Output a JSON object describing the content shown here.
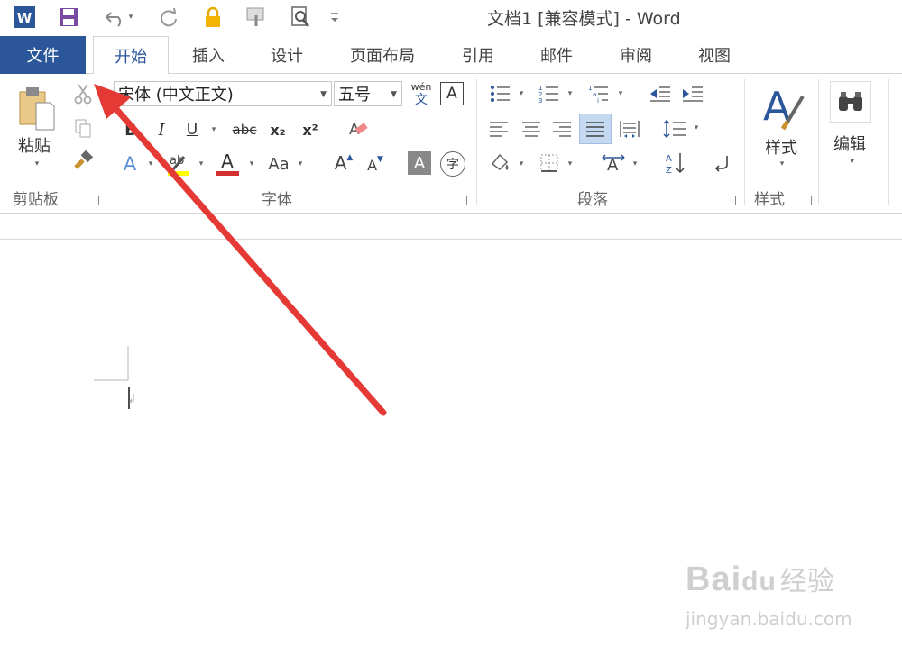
{
  "window": {
    "title": "文档1 [兼容模式] - Word"
  },
  "tabs": {
    "file": "文件",
    "home": "开始",
    "insert": "插入",
    "design": "设计",
    "layout": "页面布局",
    "references": "引用",
    "mailings": "邮件",
    "review": "审阅",
    "view": "视图"
  },
  "clipboard": {
    "paste_label": "粘贴",
    "group_label": "剪贴板"
  },
  "font": {
    "name": "宋体 (中文正文)",
    "size": "五号",
    "group_label": "字体",
    "phonetic_top": "wén",
    "phonetic_bottom": "文",
    "border_char": "A",
    "bold": "B",
    "italic": "I",
    "underline": "U",
    "strike": "abc",
    "subscript": "x₂",
    "superscript": "x²",
    "grow": "A",
    "shrink": "A",
    "change_case": "Aa",
    "effect": "A",
    "color": "A",
    "shading": "A",
    "enclose": "字"
  },
  "paragraph": {
    "group_label": "段落"
  },
  "styles": {
    "label": "样式",
    "group_label": "样式"
  },
  "editing": {
    "label": "编辑"
  },
  "colors": {
    "accent": "#2b579a",
    "highlight": "#ffff00",
    "font_color": "#d32f2f",
    "arrow": "#e53935"
  },
  "watermark": {
    "brand": "Bai",
    "brand_suffix": "du",
    "brand_cn": "经验",
    "url": "jingyan.baidu.com"
  }
}
